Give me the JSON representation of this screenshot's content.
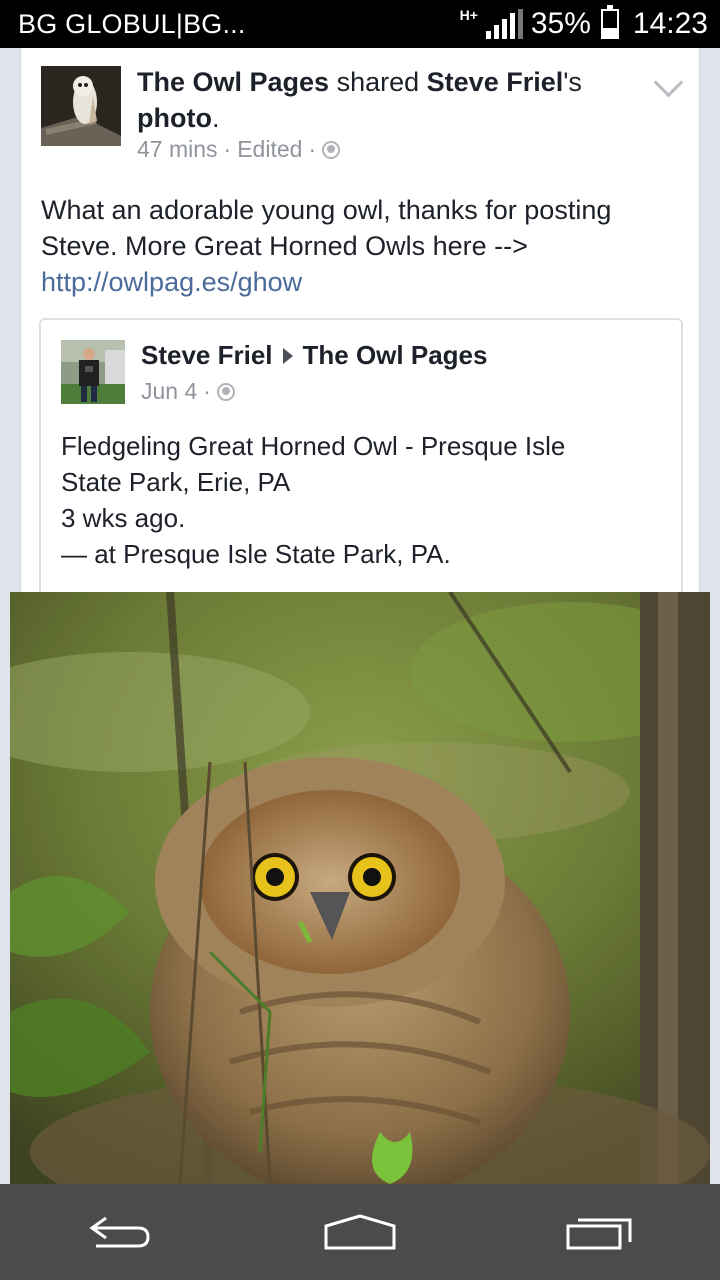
{
  "status_bar": {
    "carrier": "BG GLOBUL|BG...",
    "network_type": "H+",
    "battery_percent_text": "35%",
    "battery_level": 0.35,
    "time": "14:23"
  },
  "post": {
    "author": "The Owl Pages",
    "action_word": "shared",
    "shared_from": "Steve Friel",
    "possessive_suffix": "'s",
    "object": "photo",
    "period": ".",
    "time_ago": "47 mins",
    "edited_label": "Edited",
    "separator": "·",
    "body_line1": "What an adorable young owl, thanks for posting",
    "body_line2": "Steve. More Great Horned Owls here -->",
    "link": "http://owlpag.es/ghow"
  },
  "shared_post": {
    "author": "Steve Friel",
    "target": "The Owl Pages",
    "date": "Jun 4",
    "separator": "·",
    "line1": "Fledgeling Great Horned Owl - Presque Isle",
    "line2": "State Park, Erie, PA",
    "line3": "3 wks ago.",
    "line4": "— at Presque Isle State Park, PA."
  },
  "icons": {
    "privacy": "globe-icon",
    "menu": "chevron-down-icon",
    "back": "back-icon",
    "home": "home-icon",
    "recents": "recent-apps-icon"
  },
  "colors": {
    "link": "#4b6b9b",
    "meta": "#90949c",
    "text": "#1d2129",
    "navbar": "#4b4b4b"
  }
}
